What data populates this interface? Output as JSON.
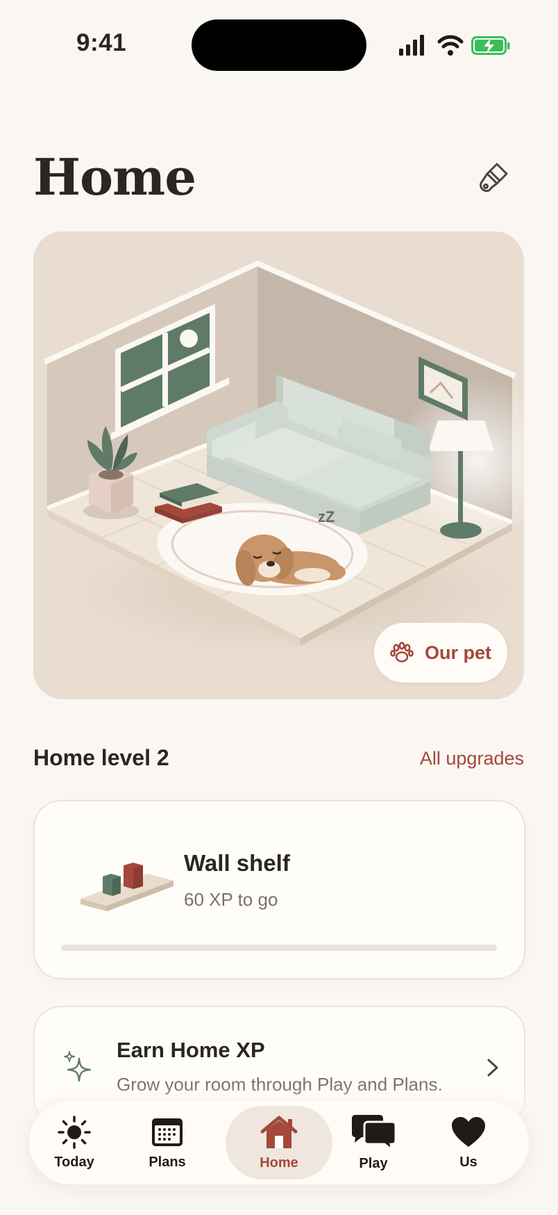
{
  "status_bar": {
    "time": "9:41",
    "icons": [
      "signal-icon",
      "wifi-icon",
      "battery-charging-icon"
    ]
  },
  "header": {
    "title": "Home",
    "customize_icon": "paintbrush-icon"
  },
  "room": {
    "pet_button_label": "Our pet",
    "pet_icon": "paw-icon",
    "sleep_text": "zZ"
  },
  "level": {
    "title": "Home level 2",
    "link": "All upgrades"
  },
  "upgrade": {
    "name": "Wall shelf",
    "xp_remaining": "60 XP to go",
    "progress": 0
  },
  "earn": {
    "title": "Earn Home XP",
    "subtitle": "Grow your room through Play and Plans."
  },
  "tabs": [
    {
      "label": "Today",
      "icon": "sun-icon",
      "active": false
    },
    {
      "label": "Plans",
      "icon": "calendar-icon",
      "active": false
    },
    {
      "label": "Home",
      "icon": "house-icon",
      "active": true
    },
    {
      "label": "Play",
      "icon": "chat-bubbles-icon",
      "active": false
    },
    {
      "label": "Us",
      "icon": "heart-icon",
      "active": false
    }
  ],
  "colors": {
    "accent": "#a3483b",
    "background": "#faf7f2",
    "card": "#fffdf9",
    "room_bg": "#e8ddd0",
    "green": "#5f7b68"
  }
}
